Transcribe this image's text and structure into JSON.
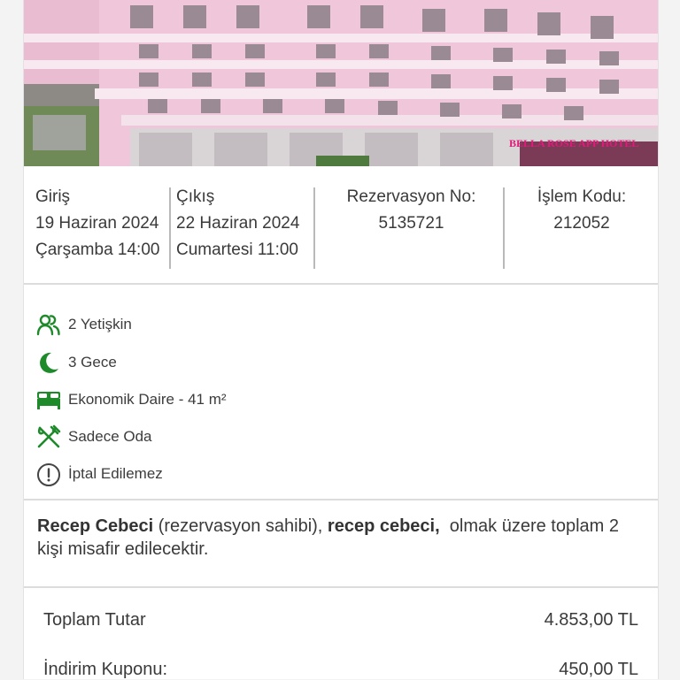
{
  "hero": {
    "hotel_sign": "BELLA ROSE APP HOTEL"
  },
  "checkin": {
    "label": "Giriş",
    "date": "19 Haziran 2024",
    "day_time": "Çarşamba 14:00"
  },
  "checkout": {
    "label": "Çıkış",
    "date": "22 Haziran 2024",
    "day_time": "Cumartesi 11:00"
  },
  "reservation": {
    "label": "Rezervasyon No:",
    "value": "5135721"
  },
  "transaction": {
    "label": "İşlem Kodu:",
    "value": "212052"
  },
  "features": [
    {
      "icon": "people-icon",
      "label": "2 Yetişkin"
    },
    {
      "icon": "moon-icon",
      "label": "3 Gece"
    },
    {
      "icon": "bed-icon",
      "label": "Ekonomik Daire - 41 m²"
    },
    {
      "icon": "utensils-icon",
      "label": "Sadece Oda"
    },
    {
      "icon": "alert-icon",
      "label": "İptal Edilemez"
    }
  ],
  "guests": {
    "owner_name": "Recep Cebeci",
    "owner_note": " (rezervasyon sahibi), ",
    "guest_name": "recep cebeci,",
    "tail": "  olmak üzere toplam 2 kişi misafir edilecektir."
  },
  "prices": [
    {
      "label": "Toplam Tutar",
      "value": "4.853,00 TL"
    },
    {
      "label": "İndirim Kuponu:",
      "value": "450,00 TL"
    }
  ],
  "colors": {
    "accent_green": "#1e8a2a",
    "hero_pink": "#ecc1d6"
  }
}
